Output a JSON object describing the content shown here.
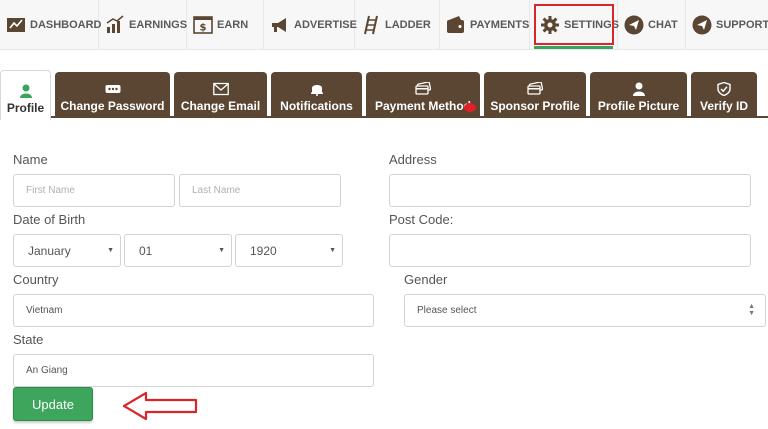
{
  "topnav": {
    "items": [
      {
        "label": "DASHBOARD",
        "icon": "dashboard-icon"
      },
      {
        "label": "EARNINGS",
        "icon": "earnings-chart-icon"
      },
      {
        "label": "EARN",
        "icon": "dollar-window-icon"
      },
      {
        "label": "ADVERTISE",
        "icon": "megaphone-icon"
      },
      {
        "label": "LADDER",
        "icon": "ladder-icon"
      },
      {
        "label": "PAYMENTS",
        "icon": "wallet-icon"
      },
      {
        "label": "SETTINGS",
        "icon": "gear-icon"
      },
      {
        "label": "CHAT",
        "icon": "paper-plane-icon"
      },
      {
        "label": "SUPPORT",
        "icon": "paper-plane-icon"
      }
    ],
    "active": "SETTINGS"
  },
  "tabs": [
    {
      "label": "Profile",
      "icon": "user-icon"
    },
    {
      "label": "Change Password",
      "icon": "password-dots-icon"
    },
    {
      "label": "Change Email",
      "icon": "envelope-icon"
    },
    {
      "label": "Notifications",
      "icon": "bell-icon"
    },
    {
      "label": "Payment Method",
      "icon": "cards-icon"
    },
    {
      "label": "Sponsor Profile",
      "icon": "cards-icon"
    },
    {
      "label": "Profile Picture",
      "icon": "user-icon"
    },
    {
      "label": "Verify ID",
      "icon": "shield-check-icon"
    }
  ],
  "form": {
    "name_label": "Name",
    "first_name_placeholder": "First Name",
    "last_name_placeholder": "Last Name",
    "dob_label": "Date of Birth",
    "dob_month": "January",
    "dob_day": "01",
    "dob_year": "1920",
    "country_label": "Country",
    "country_value": "Vietnam",
    "state_label": "State",
    "state_value": "An Giang",
    "address_label": "Address",
    "postcode_label": "Post Code:",
    "gender_label": "Gender",
    "gender_value": "Please select",
    "update_label": "Update"
  },
  "colors": {
    "tab_bg": "#5a4632",
    "button_green": "#3ea55d",
    "highlight_red": "#d9262b"
  }
}
